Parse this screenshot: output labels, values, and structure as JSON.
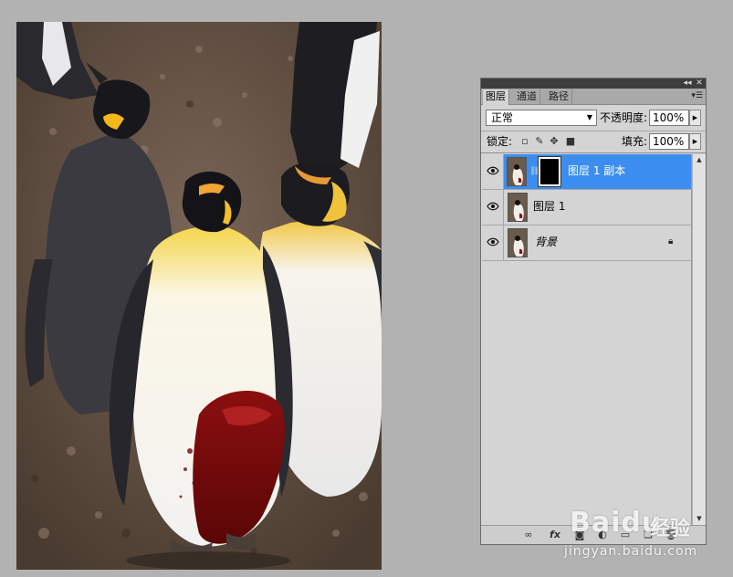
{
  "canvas": {
    "subject": "king-penguins-photo"
  },
  "panel": {
    "tabs": [
      {
        "label": "图层",
        "active": true
      },
      {
        "label": "通道",
        "active": false
      },
      {
        "label": "路径",
        "active": false
      }
    ],
    "blend_mode": "正常",
    "opacity_label": "不透明度:",
    "opacity_value": "100%",
    "lock_label": "锁定:",
    "fill_label": "填充:",
    "fill_value": "100%",
    "layers": [
      {
        "name": "图层 1 副本",
        "selected": true,
        "has_mask": true,
        "visible": true,
        "locked": false
      },
      {
        "name": "图层 1",
        "selected": false,
        "has_mask": false,
        "visible": true,
        "locked": false
      },
      {
        "name": "背景",
        "selected": false,
        "has_mask": false,
        "visible": true,
        "locked": true
      }
    ],
    "accent_color": "#3b8ef0"
  },
  "watermark": {
    "brand": "Baidu",
    "product": "经验",
    "url": "jingyan.baidu.com"
  }
}
